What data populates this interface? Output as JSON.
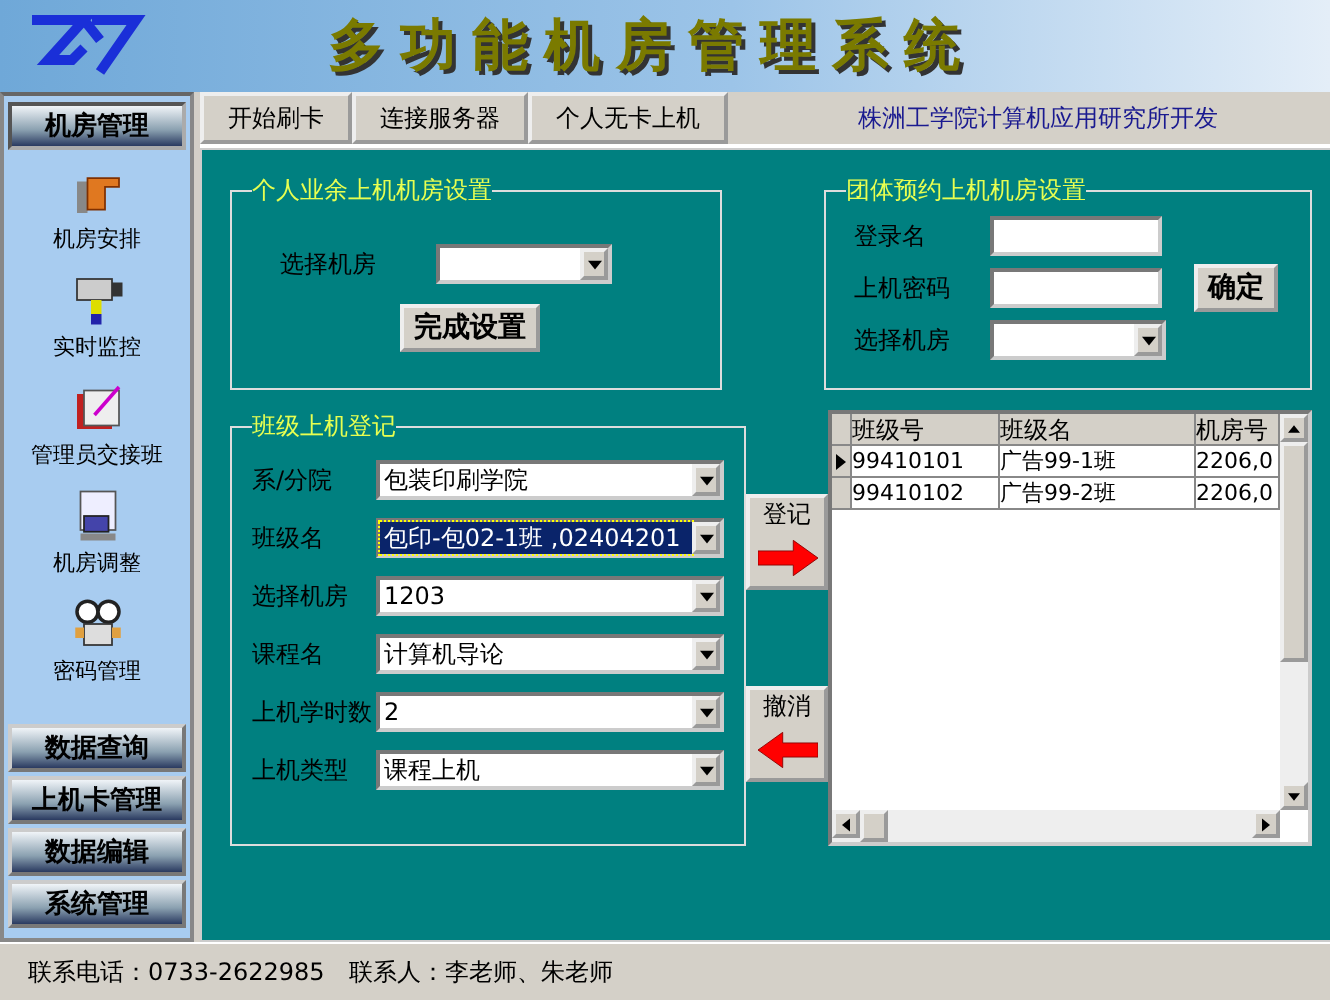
{
  "header": {
    "title": "多功能机房管理系统"
  },
  "sidebar": {
    "sections": [
      {
        "label": "机房管理",
        "expanded": true,
        "items": [
          {
            "label": "机房安排",
            "kind": "hand"
          },
          {
            "label": "实时监控",
            "kind": "camera"
          },
          {
            "label": "管理员交接班",
            "kind": "notebook"
          },
          {
            "label": "机房调整",
            "kind": "computer"
          },
          {
            "label": "密码管理",
            "kind": "robot"
          }
        ]
      },
      {
        "label": "数据查询",
        "expanded": false
      },
      {
        "label": "上机卡管理",
        "expanded": false
      },
      {
        "label": "数据编辑",
        "expanded": false
      },
      {
        "label": "系统管理",
        "expanded": false
      }
    ]
  },
  "toolbar": {
    "buttons": [
      "开始刷卡",
      "连接服务器",
      "个人无卡上机"
    ],
    "credit": "株洲工学院计算机应用研究所开发"
  },
  "personal_group": {
    "title": "个人业余上机机房设置",
    "room_label": "选择机房",
    "button": "完成设置"
  },
  "group_booking": {
    "title": "团体预约上机机房设置",
    "fields": [
      {
        "label": "登录名",
        "kind": "text"
      },
      {
        "label": "上机密码",
        "kind": "text"
      },
      {
        "label": "选择机房",
        "kind": "combo"
      }
    ],
    "button": "确定"
  },
  "class_register": {
    "title": "班级上机登记",
    "fields": [
      {
        "label": "系/分院",
        "value": "包装印刷学院",
        "selected": false
      },
      {
        "label": "班级名",
        "value": "包印-包02-1班 ,02404201",
        "selected": true
      },
      {
        "label": "选择机房",
        "value": "1203",
        "selected": false
      },
      {
        "label": "课程名",
        "value": "计算机导论",
        "selected": false
      },
      {
        "label": "上机学时数",
        "value": "2",
        "selected": false
      },
      {
        "label": "上机类型",
        "value": "课程上机",
        "selected": false
      }
    ]
  },
  "actions": [
    {
      "label": "登记",
      "kind": "right"
    },
    {
      "label": "撤消",
      "kind": "left"
    }
  ],
  "table": {
    "columns": [
      "班级号",
      "班级名",
      "机房号"
    ],
    "rows": [
      {
        "cells": [
          "99410101",
          "广告99-1班",
          "2206,0"
        ],
        "selected": true
      },
      {
        "cells": [
          "99410102",
          "广告99-2班",
          "2206,0"
        ],
        "selected": false
      }
    ]
  },
  "status_bar": {
    "phone": "联系电话：0733-2622985",
    "contact": "联系人：李老师、朱老师"
  }
}
